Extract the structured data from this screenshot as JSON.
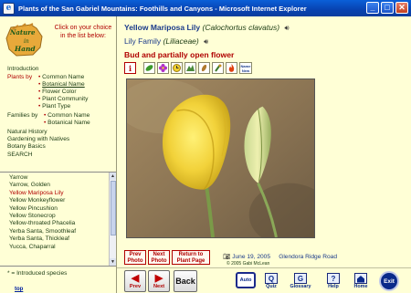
{
  "window": {
    "title": "Plants of the San Gabriel Mountains: Foothills and Canyons - Microsoft Internet Explorer",
    "app_icon": "e",
    "min": "_",
    "max": "□",
    "close": "✕"
  },
  "sidebar": {
    "logo_line1": "Nature",
    "logo_line2": "in",
    "logo_line3": "Hand",
    "instruction": "Click on your choice in the list below:",
    "nav": {
      "introduction": "Introduction",
      "plants_by": "Plants by",
      "common_name": "Common Name",
      "botanical_name": "Botanical Name",
      "flower_color": "Flower Color",
      "plant_community": "Plant Community",
      "plant_type": "Plant Type",
      "families_by": "Families by",
      "fam_common_name": "Common Name",
      "fam_botanical_name": "Botanical Name",
      "natural_history": "Natural History",
      "gardening": "Gardening with Natives",
      "botany_basics": "Botany Basics",
      "search": "SEARCH"
    },
    "species": [
      "Yarrow",
      "Yarrow, Golden",
      "Yellow Mariposa Lily",
      "Yellow Monkeyflower",
      "Yellow Pincushion",
      "Yellow Stonecrop",
      "Yellow-throated Phacelia",
      "Yerba Santa, Smoothleaf",
      "Yerba Santa, Thickleaf",
      "Yucca, Chaparral"
    ],
    "footnote": "* = Introduced species",
    "top_link": "top"
  },
  "plant": {
    "common_name": "Yellow Mariposa Lily",
    "botanical_name": "(Calochortus clavatus)",
    "family_common": "Lily Family",
    "family_botanical": "(Liliaceae)",
    "caption": "Bud and partially open flower",
    "info_icon": "i",
    "name_icon": "Name New"
  },
  "photo": {
    "prev_photo": "Prev Photo",
    "next_photo": "Next Photo",
    "return_plant_page": "Return to Plant Page",
    "date": "June 19, 2005",
    "location": "Glendora Ridge Road",
    "copyright": "© 2005 Gabi McLean"
  },
  "bottom": {
    "prev": "Prev",
    "next": "Next",
    "back": "Back",
    "auto": "Auto",
    "quiz": "Quiz",
    "glossary": "Glossary",
    "help": "Help",
    "home": "Home",
    "exit": "Exit"
  },
  "colors": {
    "title_bar": "#0842b0",
    "panel_bg": "#ffffd6",
    "accent_red": "#b00000",
    "link_blue": "#1a3a8a"
  }
}
